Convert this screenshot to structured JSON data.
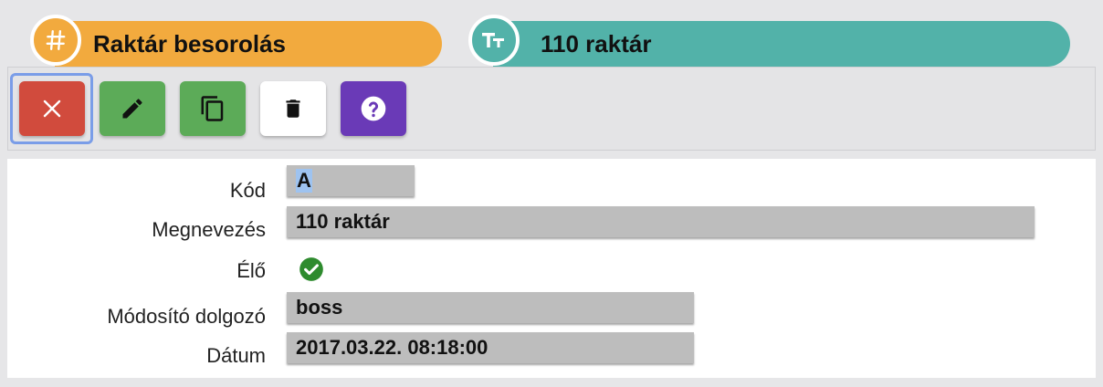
{
  "header": {
    "record_type_label": "Raktár besorolás",
    "record_type_icon": "hash-icon",
    "record_name_label": "110 raktár",
    "record_name_icon": "text-type-icon",
    "orange": "#f2aa3e",
    "teal": "#52b2a9"
  },
  "toolbar": {
    "buttons": [
      {
        "name": "close",
        "icon": "close-icon",
        "color": "#d14b3d"
      },
      {
        "name": "edit",
        "icon": "pencil-icon",
        "color": "#5cab58"
      },
      {
        "name": "copy",
        "icon": "copy-icon",
        "color": "#5cab58"
      },
      {
        "name": "delete",
        "icon": "trash-icon",
        "color": "#ffffff"
      },
      {
        "name": "help",
        "icon": "help-icon",
        "color": "#6a3ab7"
      }
    ]
  },
  "form": {
    "code": {
      "label": "Kód",
      "value": "A"
    },
    "name": {
      "label": "Megnevezés",
      "value": "110 raktár"
    },
    "active": {
      "label": "Élő",
      "checked": true,
      "icon": "check-circle-icon"
    },
    "modifier": {
      "label": "Módosító dolgozó",
      "value": "boss"
    },
    "date": {
      "label": "Dátum",
      "value": "2017.03.22. 08:18:00"
    }
  }
}
